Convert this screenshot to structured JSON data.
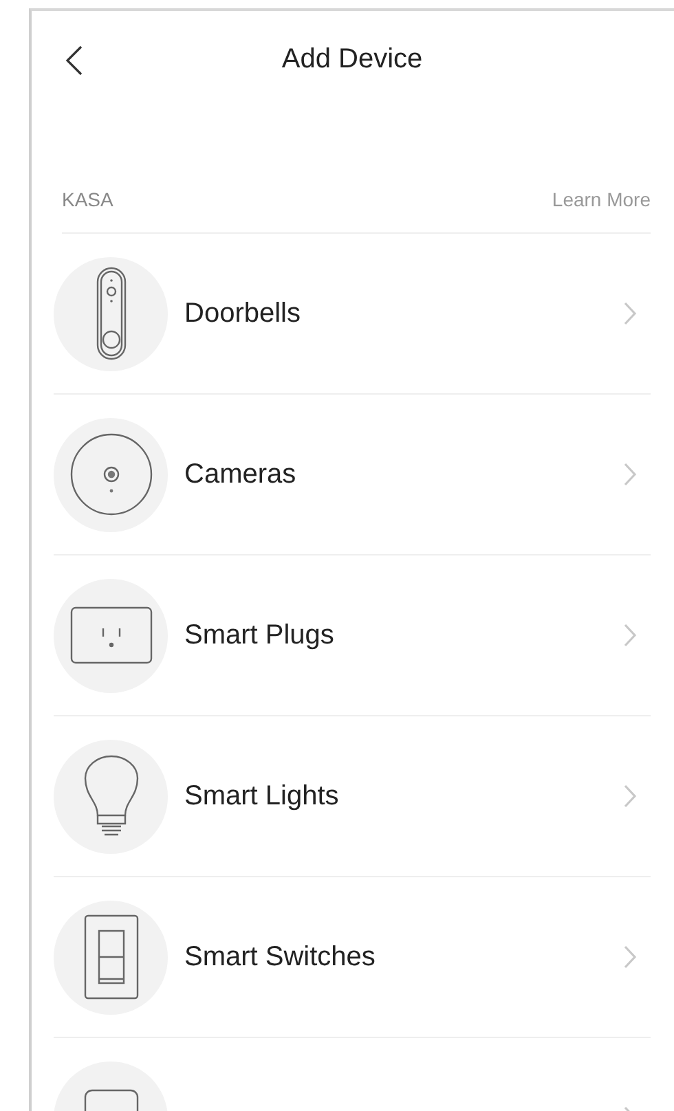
{
  "header": {
    "title": "Add Device"
  },
  "section": {
    "title": "KASA",
    "link": "Learn More"
  },
  "items": [
    {
      "kind": "doorbell",
      "label": "Doorbells"
    },
    {
      "kind": "camera",
      "label": "Cameras"
    },
    {
      "kind": "plug",
      "label": "Smart Plugs"
    },
    {
      "kind": "light",
      "label": "Smart Lights"
    },
    {
      "kind": "switch",
      "label": "Smart Switches"
    },
    {
      "kind": "hub"
    }
  ]
}
